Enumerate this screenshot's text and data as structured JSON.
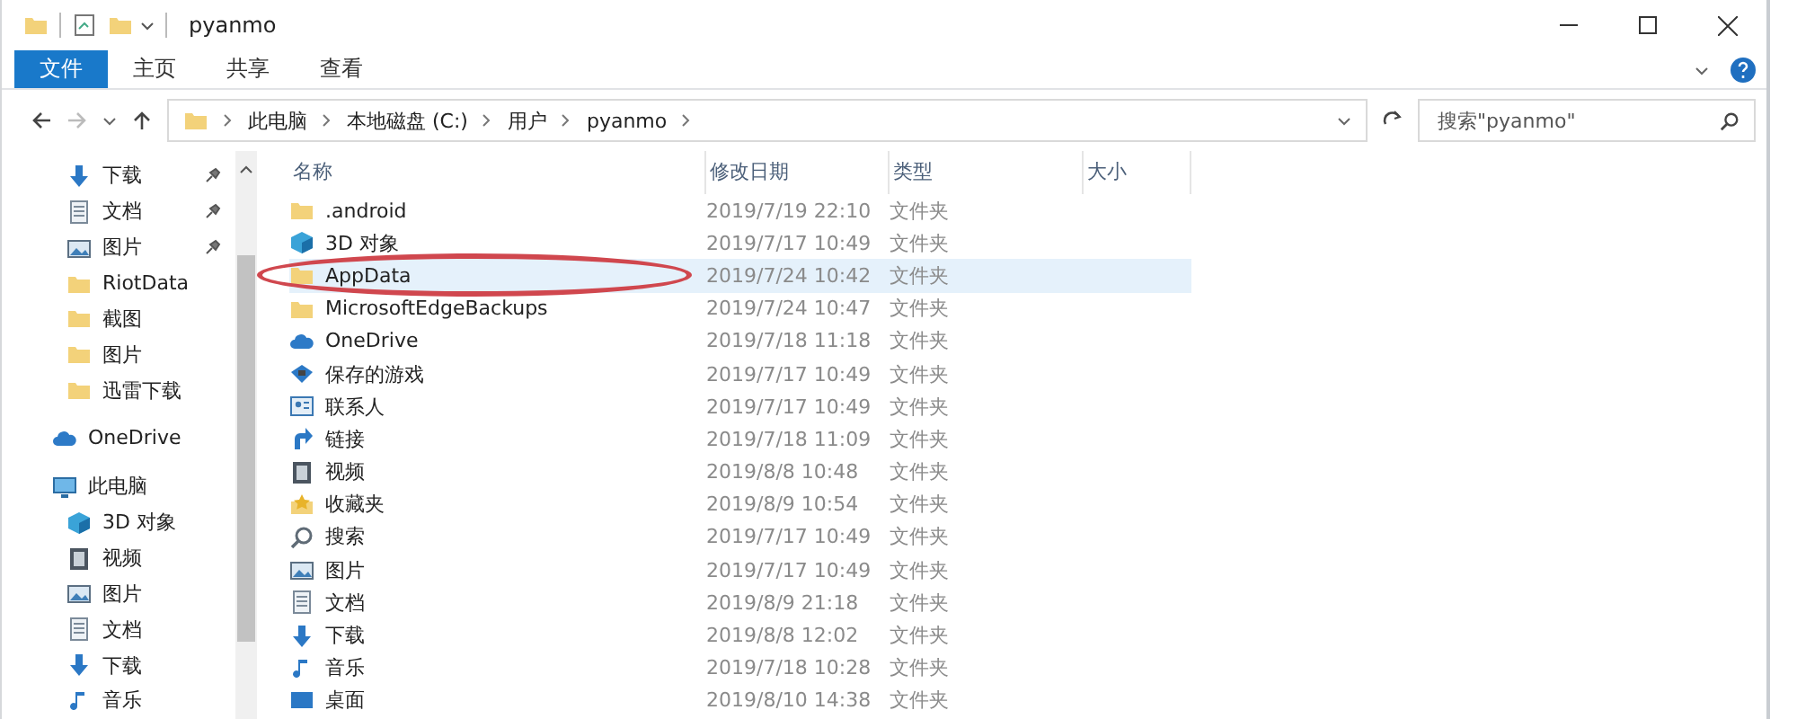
{
  "window": {
    "title": "pyanmo"
  },
  "ribbon_tabs": [
    {
      "label": "文件",
      "selected": true
    },
    {
      "label": "主页",
      "selected": false
    },
    {
      "label": "共享",
      "selected": false
    },
    {
      "label": "查看",
      "selected": false
    }
  ],
  "address_bar": {
    "path": [
      "此电脑",
      "本地磁盘 (C:)",
      "用户",
      "pyanmo"
    ]
  },
  "search": {
    "placeholder": "搜索\"pyanmo\""
  },
  "nav_pane": {
    "items": [
      {
        "label": "下载",
        "kind": "download",
        "pinned": true
      },
      {
        "label": "文档",
        "kind": "document",
        "pinned": true
      },
      {
        "label": "图片",
        "kind": "picture",
        "pinned": true
      },
      {
        "label": "RiotData",
        "kind": "folder",
        "pinned": false
      },
      {
        "label": "截图",
        "kind": "folder",
        "pinned": false
      },
      {
        "label": "图片",
        "kind": "folder",
        "pinned": false
      },
      {
        "label": "迅雷下载",
        "kind": "folder",
        "pinned": false
      },
      {
        "label": "OneDrive",
        "kind": "cloud",
        "pinned": false,
        "section": true
      },
      {
        "label": "此电脑",
        "kind": "computer",
        "pinned": false,
        "section": true
      },
      {
        "label": "3D 对象",
        "kind": "cube",
        "pinned": false
      },
      {
        "label": "视频",
        "kind": "video",
        "pinned": false
      },
      {
        "label": "图片",
        "kind": "picture",
        "pinned": false
      },
      {
        "label": "文档",
        "kind": "document",
        "pinned": false
      },
      {
        "label": "下载",
        "kind": "download",
        "pinned": false
      },
      {
        "label": "音乐",
        "kind": "music",
        "pinned": false
      }
    ]
  },
  "file_list": {
    "columns": [
      "名称",
      "修改日期",
      "类型",
      "大小"
    ],
    "rows": [
      {
        "name": ".android",
        "modified": "2019/7/19 22:10",
        "type": "文件夹",
        "kind": "folder",
        "selected": false
      },
      {
        "name": "3D 对象",
        "modified": "2019/7/17 10:49",
        "type": "文件夹",
        "kind": "cube",
        "selected": false
      },
      {
        "name": "AppData",
        "modified": "2019/7/24 10:42",
        "type": "文件夹",
        "kind": "folder",
        "selected": true,
        "circled": true
      },
      {
        "name": "MicrosoftEdgeBackups",
        "modified": "2019/7/24 10:47",
        "type": "文件夹",
        "kind": "folder",
        "selected": false
      },
      {
        "name": "OneDrive",
        "modified": "2019/7/18 11:18",
        "type": "文件夹",
        "kind": "cloud",
        "selected": false
      },
      {
        "name": "保存的游戏",
        "modified": "2019/7/17 10:49",
        "type": "文件夹",
        "kind": "game",
        "selected": false
      },
      {
        "name": "联系人",
        "modified": "2019/7/17 10:49",
        "type": "文件夹",
        "kind": "contacts",
        "selected": false
      },
      {
        "name": "链接",
        "modified": "2019/7/18 11:09",
        "type": "文件夹",
        "kind": "link",
        "selected": false
      },
      {
        "name": "视频",
        "modified": "2019/8/8 10:48",
        "type": "文件夹",
        "kind": "video",
        "selected": false
      },
      {
        "name": "收藏夹",
        "modified": "2019/8/9 10:54",
        "type": "文件夹",
        "kind": "star",
        "selected": false
      },
      {
        "name": "搜索",
        "modified": "2019/7/17 10:49",
        "type": "文件夹",
        "kind": "search",
        "selected": false
      },
      {
        "name": "图片",
        "modified": "2019/7/17 10:49",
        "type": "文件夹",
        "kind": "picture",
        "selected": false
      },
      {
        "name": "文档",
        "modified": "2019/8/9 21:18",
        "type": "文件夹",
        "kind": "document",
        "selected": false
      },
      {
        "name": "下载",
        "modified": "2019/8/8 12:02",
        "type": "文件夹",
        "kind": "download",
        "selected": false
      },
      {
        "name": "音乐",
        "modified": "2019/7/18 10:28",
        "type": "文件夹",
        "kind": "music",
        "selected": false
      },
      {
        "name": "桌面",
        "modified": "2019/8/10 14:38",
        "type": "文件夹",
        "kind": "desktop",
        "selected": false
      }
    ]
  }
}
